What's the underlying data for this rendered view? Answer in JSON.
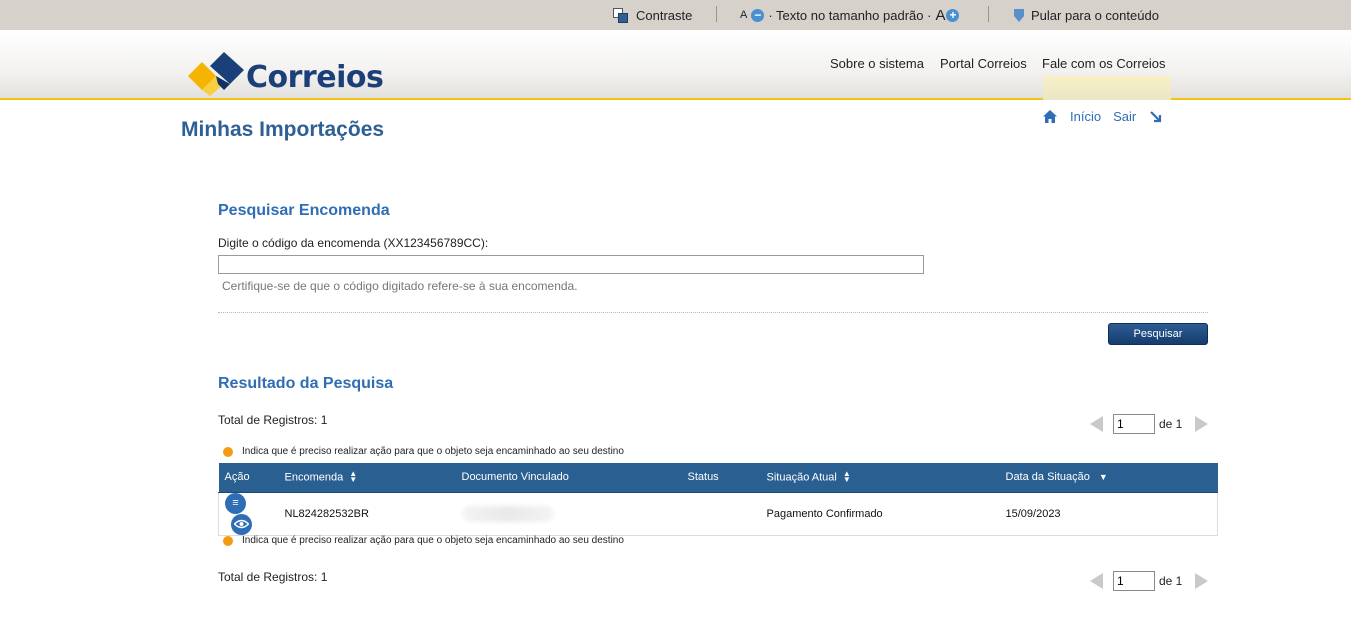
{
  "accessibility_bar": {
    "contrast_label": "Contraste",
    "font_small": "A",
    "font_default_label": "· Texto no tamanho padrão ·",
    "font_big": "A",
    "skip_label": "Pular para o conteúdo"
  },
  "header": {
    "logo_text": "Correios",
    "nav": [
      "Sobre o sistema",
      "Portal Correios",
      "Fale com os Correios"
    ],
    "brand_colors": {
      "blue": "#1b3f78",
      "yellow": "#f1c40f"
    }
  },
  "page": {
    "title": "Minhas Importações",
    "user_links": {
      "home_label": "Início",
      "logout_label": "Sair"
    }
  },
  "search": {
    "title": "Pesquisar Encomenda",
    "label": "Digite o código da encomenda (XX123456789CC):",
    "value": "",
    "hint": "Certifique-se de que o código digitado refere-se à sua encomenda.",
    "button_label": "Pesquisar"
  },
  "results": {
    "title": "Resultado da Pesquisa",
    "total_label": "Total de Registros: 1",
    "legend_text": "Indica que é preciso realizar ação para que o objeto seja encaminhado ao seu destino",
    "legend_color": "#f39c12",
    "pager": {
      "page": "1",
      "of_label": "de 1"
    },
    "columns": {
      "action": "Ação",
      "parcel": "Encomenda",
      "document": "Documento Vinculado",
      "status": "Status",
      "situation": "Situação Atual",
      "date": "Data da Situação"
    },
    "rows": [
      {
        "parcel": "NL824282532BR",
        "document": "",
        "status": "",
        "situation": "Pagamento Confirmado",
        "date": "15/09/2023"
      }
    ]
  }
}
